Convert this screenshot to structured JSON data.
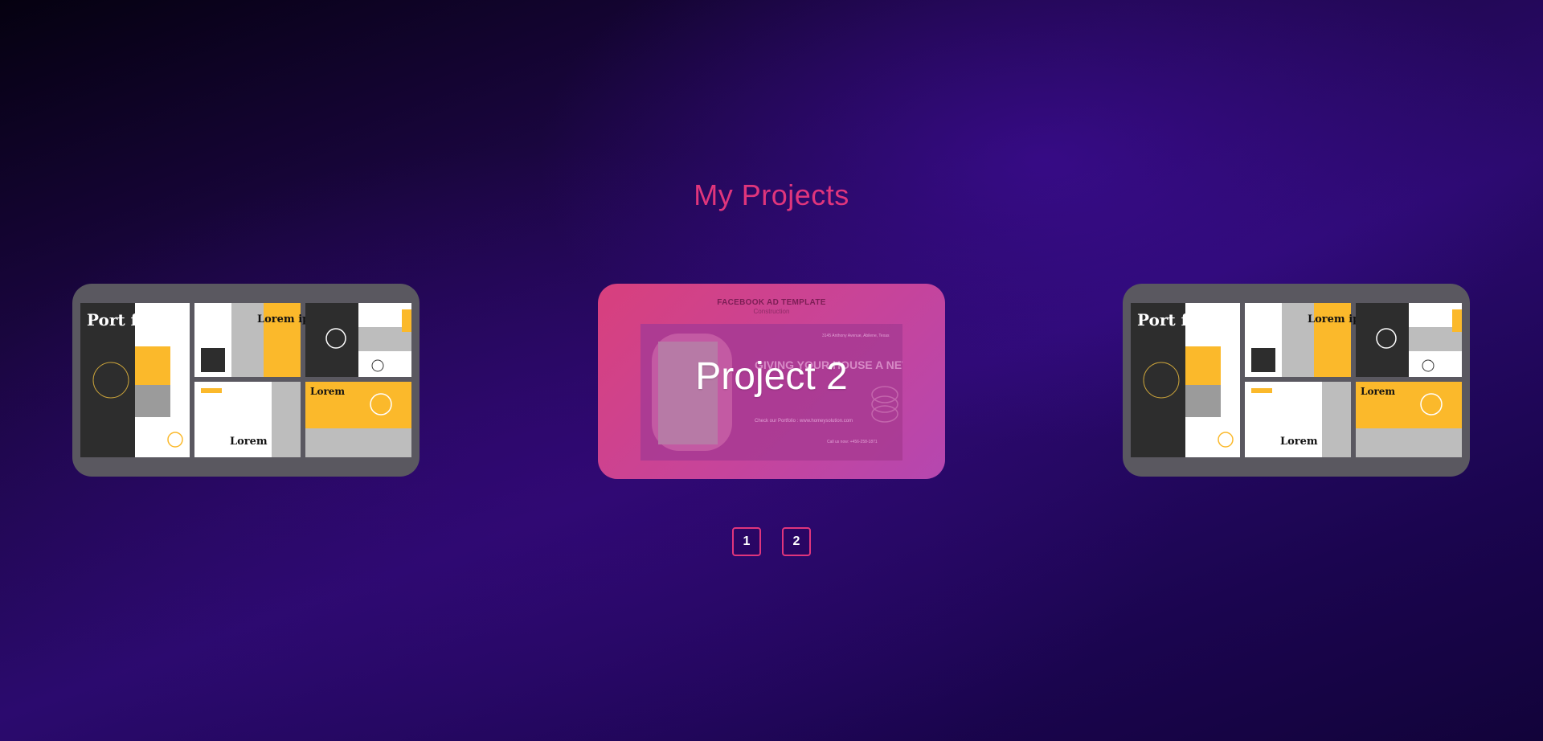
{
  "section": {
    "title": "My Projects"
  },
  "projects": [
    {
      "thumb_text": {
        "cover": "Port folio",
        "heading": "Lorem ipsum"
      }
    },
    {
      "label": "Project 2",
      "thumb_text": {
        "title": "FACEBOOK AD TEMPLATE",
        "subtitle": "Construction",
        "headline": "GIVING YOUR HOUSE A NEW STYLE",
        "website": "Check our Portfolio : www.homeysolution.com",
        "address": "3145 Anthony Avenue, Abilene, Texas",
        "phone": "Call us now: +456-258-1871"
      }
    },
    {
      "thumb_text": {
        "cover": "Port folio",
        "heading": "Lorem ipsum"
      }
    }
  ],
  "pagination": {
    "pages": [
      "1",
      "2"
    ]
  },
  "colors": {
    "accent": "#e0357c",
    "card_bg": "#5a5860",
    "brochure_yellow": "#fbb92b",
    "brochure_dark": "#2d2d2d"
  }
}
